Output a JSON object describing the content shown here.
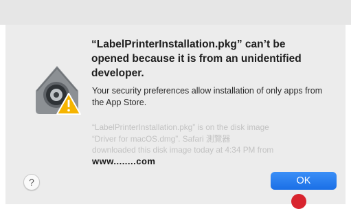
{
  "dialog": {
    "title": "“LabelPrinterInstallation.pkg” can’t be opened because it is from an unidentified developer.",
    "body": "Your security preferences allow installation of only apps from the App Store.",
    "info_lines": [
      "“LabelPrinterInstallation.pkg” is on the disk image",
      "“Driver for macOS.dmg”. Safari 測覽器",
      "downloaded this disk image today at 4:34 PM from"
    ],
    "site": "www........com",
    "ok_label": "OK",
    "help_label": "?"
  },
  "icon": "gatekeeper-lock-warning-icon",
  "colors": {
    "ok_button": "#1a6fe6",
    "warning": "#f5b400",
    "dialog_bg": "#ececec",
    "badge": "#d8242e"
  }
}
